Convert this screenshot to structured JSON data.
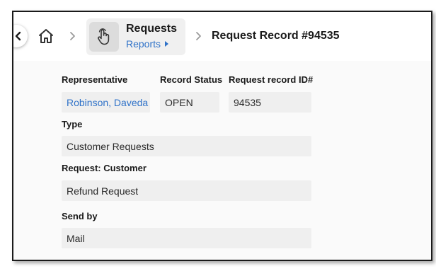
{
  "breadcrumb": {
    "app_title": "Requests",
    "app_subtitle": "Reports",
    "current_page": "Request Record #94535"
  },
  "icons": {
    "back": "chevron-left-icon",
    "home": "home-icon",
    "separator": "chevron-right-icon",
    "app": "hand-pointer-icon",
    "subtitle_arrow": "caret-right-icon"
  },
  "colors": {
    "link": "#2f72c8",
    "field_background": "#efefef"
  },
  "form": {
    "representative": {
      "label": "Representative",
      "value": "Robinson, Daveda"
    },
    "record_status": {
      "label": "Record Status",
      "value": "OPEN"
    },
    "record_id": {
      "label": "Request record ID#",
      "value": "94535"
    },
    "type": {
      "label": "Type",
      "value": "Customer Requests"
    },
    "request_customer": {
      "label": "Request: Customer",
      "value": "Refund Request"
    },
    "send_by": {
      "label": "Send by",
      "value": "Mail"
    }
  }
}
